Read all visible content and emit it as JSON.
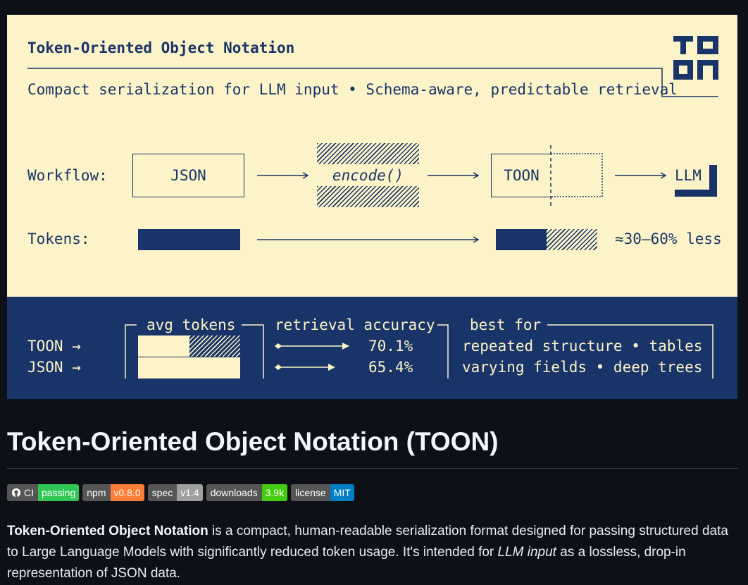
{
  "banner": {
    "heading": "Token-Oriented Object Notation",
    "subtitle": "Compact serialization for LLM input • Schema-aware, predictable retrieval",
    "logo_text": "TOON",
    "workflow": {
      "label": "Workflow:",
      "steps": [
        "JSON",
        "encode()",
        "TOON",
        "LLM"
      ]
    },
    "tokens": {
      "label": "Tokens:",
      "input_fraction": 1.0,
      "output_fraction": 0.5,
      "reduction_text": "≈30–60% less"
    },
    "comparison": {
      "row_labels": [
        "TOON →",
        "JSON →"
      ],
      "avg_tokens_label": "avg tokens",
      "retrieval_label": "retrieval accuracy",
      "best_for_label": "best for",
      "accuracy": [
        "70.1%",
        "65.4%"
      ],
      "best_for": [
        "repeated structure • tables",
        "varying fields • deep trees"
      ]
    }
  },
  "page": {
    "title": "Token-Oriented Object Notation (TOON)"
  },
  "badges": [
    {
      "icon": "github-icon",
      "label": "CI",
      "value": "passing",
      "color": "#31c754"
    },
    {
      "label": "npm",
      "value": "v0.8.0",
      "color": "#fe7d37"
    },
    {
      "label": "spec",
      "value": "v1.4",
      "color": "#9f9f9f"
    },
    {
      "label": "downloads",
      "value": "3.9k",
      "color": "#44cc11"
    },
    {
      "label": "license",
      "value": "MIT",
      "color": "#007ec6"
    }
  ],
  "intro": {
    "strong": "Token-Oriented Object Notation",
    "part1": " is a compact, human-readable serialization format designed for passing structured data to Large Language Models with significantly reduced token usage. It's intended for ",
    "em": "LLM input",
    "part2": " as a lossless, drop-in representation of JSON data."
  },
  "colors": {
    "background": "#0d1117",
    "banner_cream": "#fdf3c8",
    "banner_navy": "#183468",
    "rule": "#3d444d"
  }
}
